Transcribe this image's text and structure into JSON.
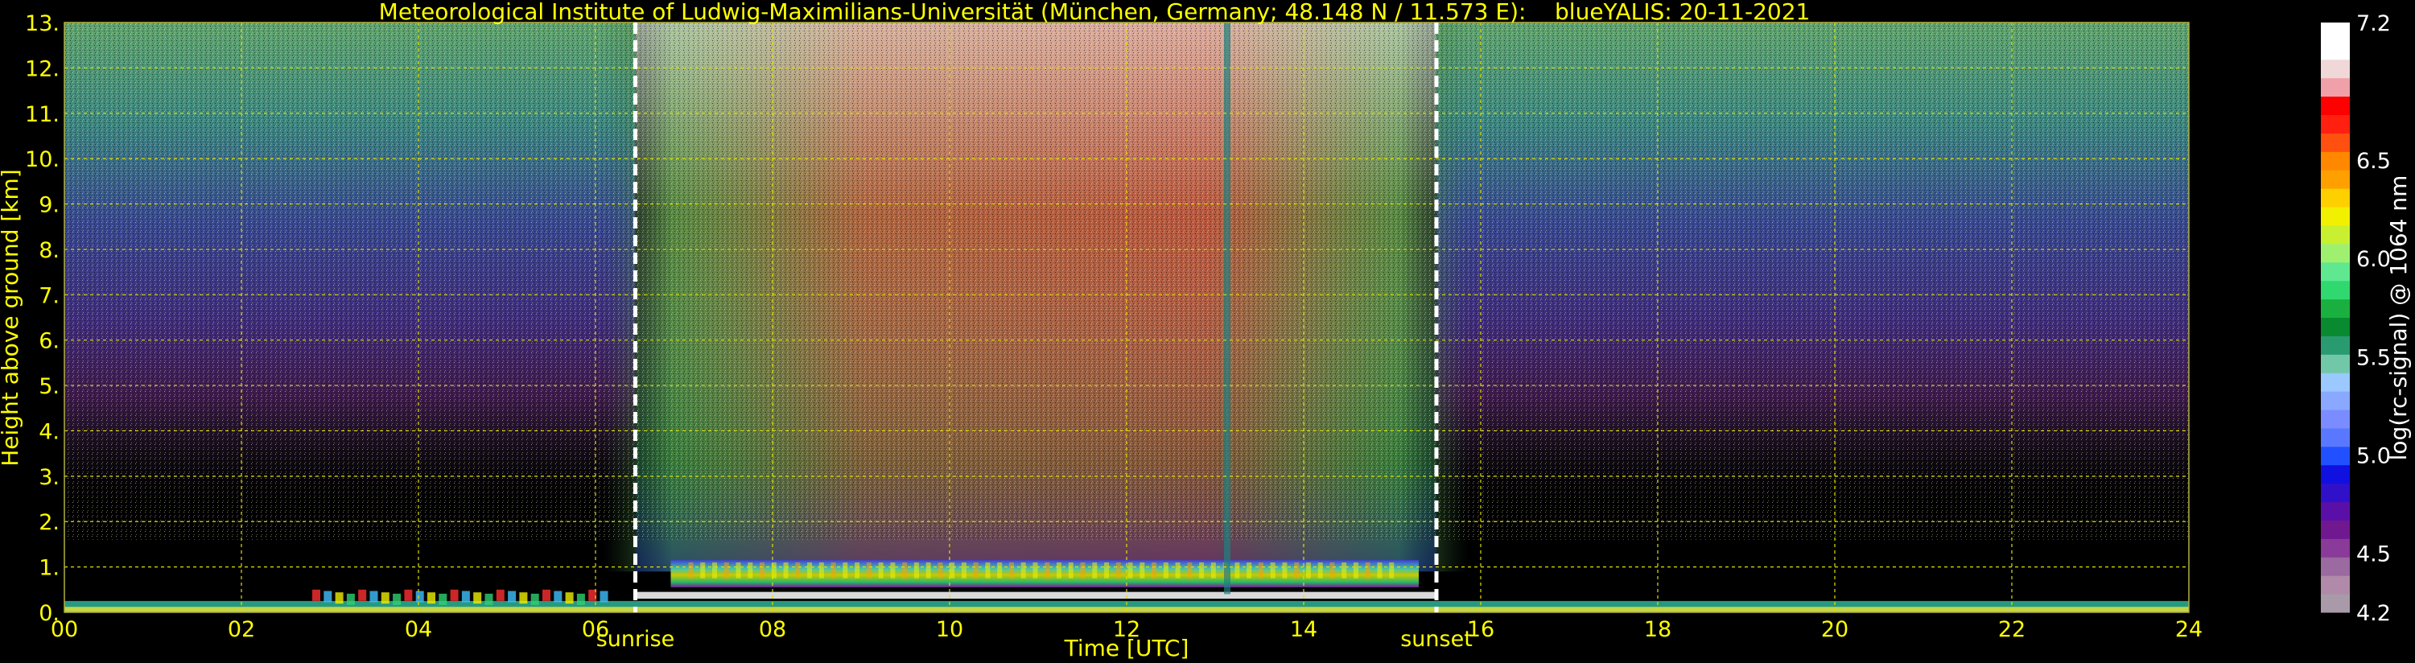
{
  "chart_data": {
    "type": "heatmap",
    "title": "Meteorological Institute of Ludwig-Maximilians-Universität (München, Germany; 48.148 N / 11.573 E):    blueYALIS: 20-11-2021",
    "xlabel": "Time [UTC]",
    "ylabel": "Height above ground [km]",
    "xlim": [
      0,
      24
    ],
    "ylim": [
      0,
      13
    ],
    "x_ticks": [
      "00",
      "02",
      "04",
      "06",
      "08",
      "10",
      "12",
      "14",
      "16",
      "18",
      "20",
      "22",
      "24"
    ],
    "y_ticks": [
      "0.",
      "1.",
      "2.",
      "3.",
      "4.",
      "5.",
      "6.",
      "7.",
      "8.",
      "9.",
      "10.",
      "11.",
      "12.",
      "13."
    ],
    "grid": true,
    "annotations": [
      {
        "label": "sunrise",
        "x": 6.45
      },
      {
        "label": "sunset",
        "x": 15.5
      }
    ],
    "colorbar": {
      "label": "log(rc-signal) @ 1064 nm",
      "range": [
        4.2,
        7.2
      ],
      "ticks": [
        "7.2",
        "6.5",
        "6.0",
        "5.5",
        "5.0",
        "4.5",
        "4.2"
      ],
      "tick_values": [
        7.2,
        6.5,
        6.0,
        5.5,
        5.0,
        4.5,
        4.2
      ],
      "colors": [
        "#a89aa8",
        "#b08aa8",
        "#9a6aa0",
        "#8a3a98",
        "#701890",
        "#5a10a8",
        "#3010c8",
        "#1010e0",
        "#2050ff",
        "#5a78ff",
        "#7a8cff",
        "#8aa8ff",
        "#9ac8ff",
        "#70c8a8",
        "#2a9a70",
        "#0a8a30",
        "#1ab040",
        "#30d870",
        "#60e890",
        "#a0f070",
        "#c8f030",
        "#f0f000",
        "#ffd000",
        "#ffa000",
        "#ff8800",
        "#ff5010",
        "#ff2010",
        "#ff0000",
        "#f0a0a8",
        "#f0d8d8",
        "#ffffff",
        "#ffffff"
      ]
    }
  }
}
